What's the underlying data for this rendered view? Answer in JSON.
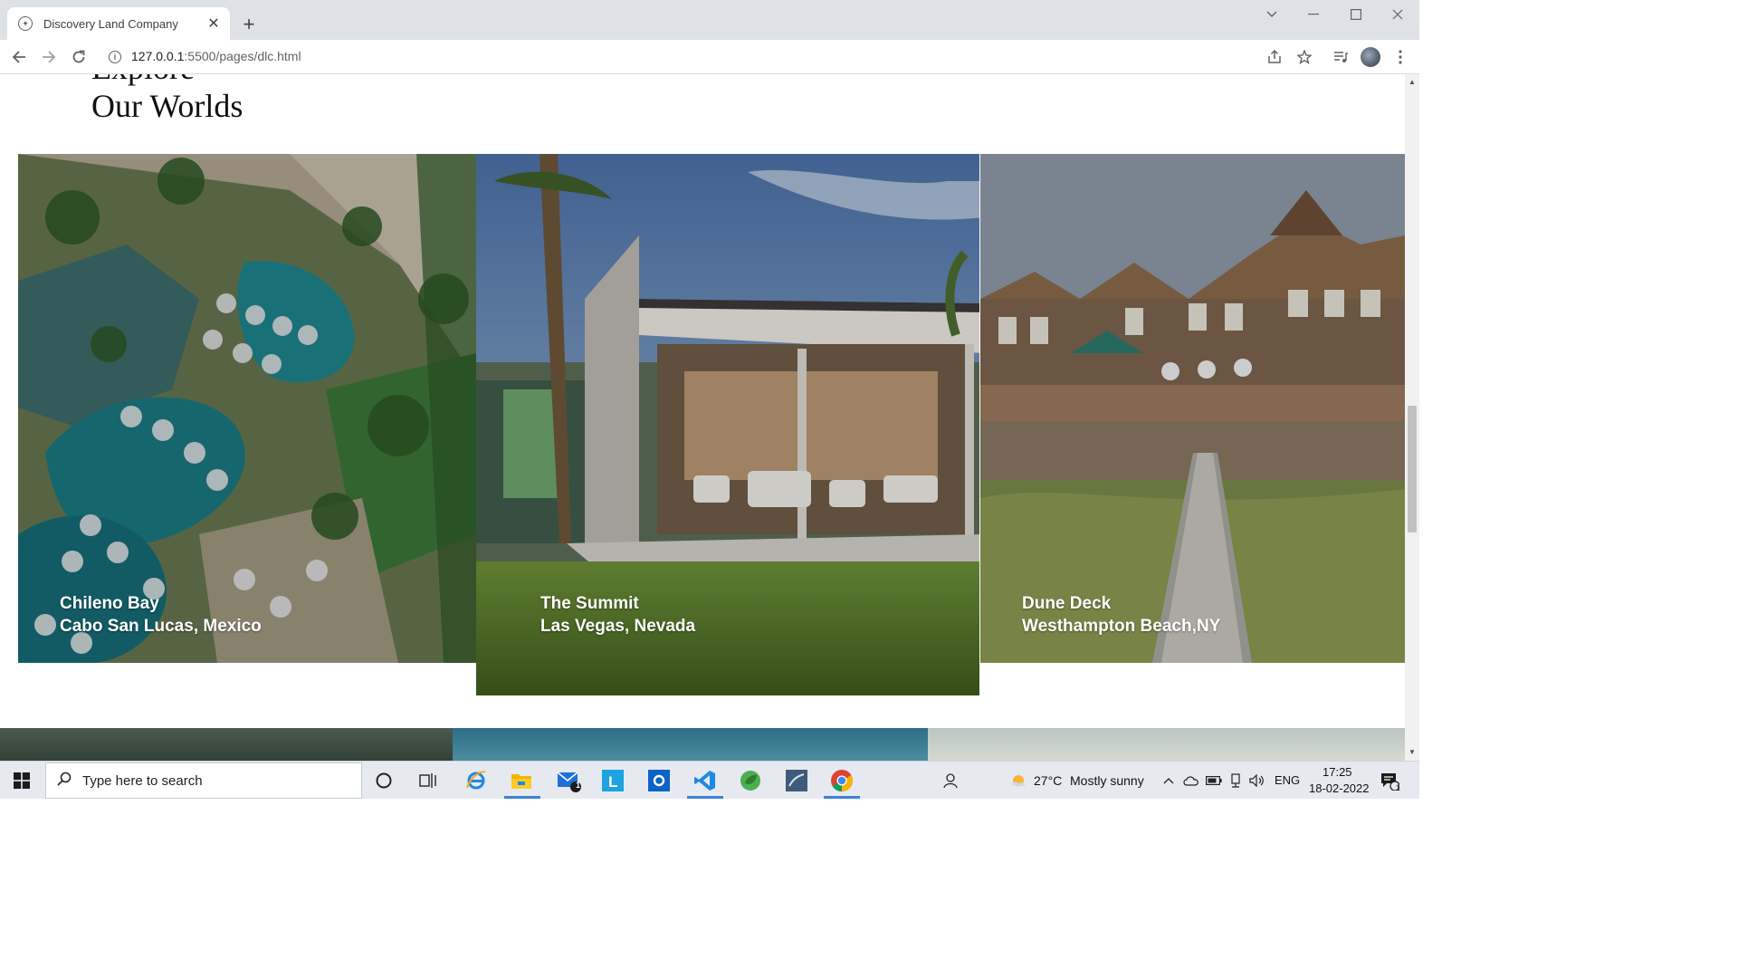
{
  "browser": {
    "tab_title": "Discovery Land Company",
    "url_host": "127.0.0.1",
    "url_path": ":5500/pages/dlc.html"
  },
  "page": {
    "heading_line1": "Explore",
    "heading_line2": "Our Worlds",
    "cards": [
      {
        "name": "Chileno Bay",
        "location": "Cabo San Lucas, Mexico"
      },
      {
        "name": "The Summit",
        "location": "Las Vegas, Nevada"
      },
      {
        "name": "Dune Deck",
        "location": "Westhampton Beach,NY"
      }
    ]
  },
  "taskbar": {
    "search_placeholder": "Type here to search",
    "mail_badge": "1",
    "weather_temp": "27°C",
    "weather_text": "Mostly sunny",
    "language": "ENG",
    "time": "17:25",
    "date": "18-02-2022",
    "notification_count": "1"
  },
  "colors": {
    "accent": "#3b82d6",
    "chrome_bg": "#dee1e6",
    "taskbar_bg": "#e6e9ef"
  }
}
